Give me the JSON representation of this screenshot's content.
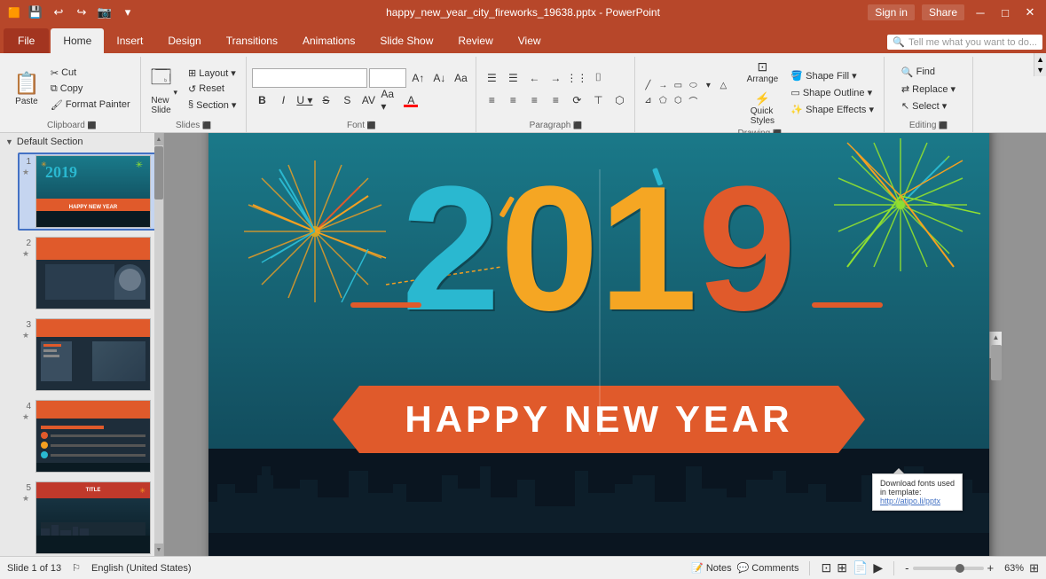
{
  "titleBar": {
    "filename": "happy_new_year_city_fireworks_19638.pptx - PowerPoint",
    "winControls": [
      "─",
      "□",
      "✕"
    ],
    "quickAccess": [
      "💾",
      "↩",
      "↪",
      "📷",
      "⚙"
    ],
    "signIn": "Sign in",
    "share": "Share"
  },
  "ribbonTabs": {
    "tabs": [
      "File",
      "Home",
      "Insert",
      "Design",
      "Transitions",
      "Animations",
      "Slide Show",
      "Review",
      "View"
    ],
    "active": "Home",
    "search": "Tell me what you want to do...",
    "searchIcon": "🔍"
  },
  "ribbon": {
    "groups": [
      {
        "id": "clipboard",
        "label": "Clipboard",
        "buttons": [
          {
            "id": "paste",
            "icon": "📋",
            "label": "Paste"
          },
          {
            "id": "cut",
            "icon": "✂",
            "label": ""
          },
          {
            "id": "copy",
            "icon": "📄",
            "label": ""
          },
          {
            "id": "format-painter",
            "icon": "🖌",
            "label": ""
          }
        ]
      },
      {
        "id": "slides",
        "label": "Slides",
        "buttons": [
          {
            "id": "new-slide",
            "icon": "＋",
            "label": "New Slide"
          },
          {
            "id": "layout",
            "icon": "⊞",
            "label": "Layout"
          },
          {
            "id": "reset",
            "icon": "↺",
            "label": "Reset"
          },
          {
            "id": "section",
            "icon": "§",
            "label": "Section"
          }
        ]
      },
      {
        "id": "font",
        "label": "Font",
        "fontName": "",
        "fontSize": "",
        "formatButtons": [
          "B",
          "I",
          "U",
          "S",
          "aa",
          "A↑",
          "A↓",
          "A",
          "A"
        ]
      },
      {
        "id": "paragraph",
        "label": "Paragraph",
        "buttons": [
          "≡",
          "≡",
          "≡",
          "≡",
          "≡",
          "¶",
          "←",
          "→",
          "↕"
        ]
      },
      {
        "id": "drawing",
        "label": "Drawing",
        "buttons": [
          "Arrange",
          "Quick Styles"
        ],
        "rightButtons": [
          "Shape Fill ▾",
          "Shape Outline ▾",
          "Shape Effects ▾"
        ]
      },
      {
        "id": "editing",
        "label": "Editing",
        "buttons": [
          "Find",
          "Replace",
          "Select ▾"
        ]
      }
    ]
  },
  "slidePanel": {
    "sectionLabel": "Default Section",
    "slides": [
      {
        "num": 1,
        "active": true,
        "theme": "slide1"
      },
      {
        "num": 2,
        "active": false,
        "theme": "slide2"
      },
      {
        "num": 3,
        "active": false,
        "theme": "slide3"
      },
      {
        "num": 4,
        "active": false,
        "theme": "slide4"
      },
      {
        "num": 5,
        "active": false,
        "theme": "slide5"
      }
    ]
  },
  "mainSlide": {
    "yearDigits": [
      "2",
      "0",
      "1",
      "9"
    ],
    "bannerText": "HAPPY NEW YEAR",
    "tooltip": {
      "line1": "Download fonts used",
      "line2": "in template:",
      "link": "http://atipo.li/pptx"
    }
  },
  "statusBar": {
    "slideInfo": "Slide 1 of 13",
    "language": "English (United States)",
    "notes": "Notes",
    "comments": "Comments",
    "views": [
      "Normal",
      "Slide Sorter",
      "Reading",
      "Slide Show"
    ],
    "zoomPercent": "63%",
    "zoomIn": "+",
    "zoomOut": "-"
  }
}
